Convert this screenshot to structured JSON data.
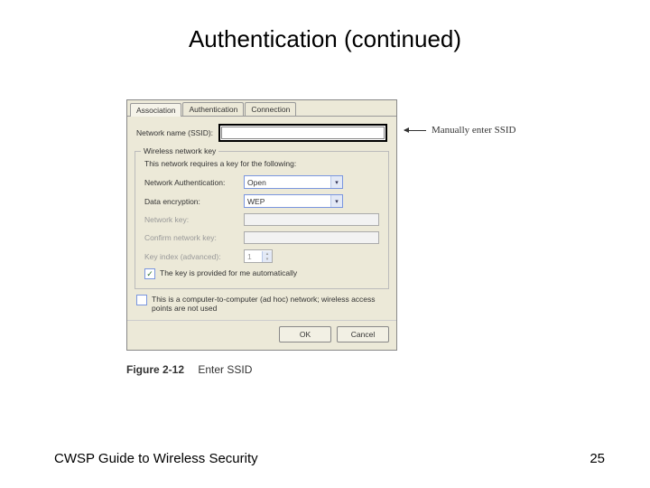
{
  "slide": {
    "title": "Authentication (continued)"
  },
  "dialog": {
    "tabs": [
      "Association",
      "Authentication",
      "Connection"
    ],
    "ssid": {
      "label": "Network name (SSID):",
      "value": ""
    },
    "group": {
      "title": "Wireless network key",
      "desc": "This network requires a key for the following:",
      "auth_label": "Network Authentication:",
      "auth_value": "Open",
      "enc_label": "Data encryption:",
      "enc_value": "WEP",
      "key_label": "Network key:",
      "confirm_label": "Confirm network key:",
      "index_label": "Key index (advanced):",
      "index_value": "1",
      "auto_check_label": "The key is provided for me automatically",
      "auto_checked": "✓"
    },
    "adhoc": {
      "label": "This is a computer-to-computer (ad hoc) network; wireless access points are not used",
      "checked": ""
    },
    "buttons": {
      "ok": "OK",
      "cancel": "Cancel"
    }
  },
  "annotation": {
    "text": "Manually enter SSID"
  },
  "caption": {
    "number": "Figure 2-12",
    "text": "Enter SSID"
  },
  "footer": {
    "text": "CWSP Guide to Wireless Security",
    "page": "25"
  }
}
